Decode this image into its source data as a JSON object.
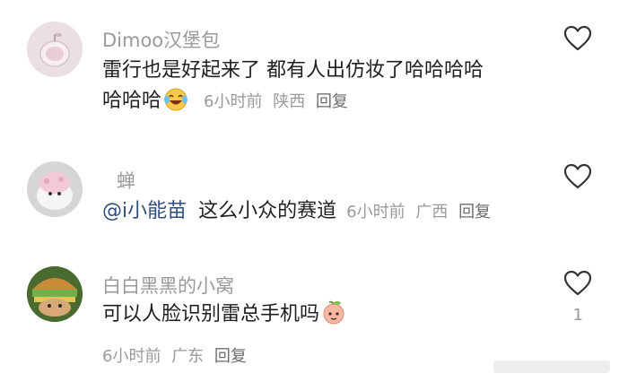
{
  "comments": [
    {
      "username": "Dimoo汉堡包",
      "text_line1": "雷行也是好起来了 都有人出仿妆了哈哈哈哈",
      "text_line2": "哈哈哈",
      "emoji": "laughing-tears-emoji",
      "time": "6小时前",
      "location": "陕西",
      "reply": "回复",
      "like_icon": "heart-outline-icon"
    },
    {
      "username": "蝉",
      "mention": "@i小能苗",
      "text": "这么小众的赛道",
      "time": "6小时前",
      "location": "广西",
      "reply": "回复",
      "like_icon": "heart-outline-icon"
    },
    {
      "username": "白白黑黑的小窝",
      "text": "可以人脸识别雷总手机吗",
      "emoji": "peach-face-emoji",
      "time": "6小时前",
      "location": "广东",
      "reply": "回复",
      "like_icon": "heart-outline-icon",
      "like_count": "1"
    }
  ],
  "colors": {
    "username": "#9a9a9a",
    "text": "#1f1f1f",
    "mention": "#2f4d7e",
    "meta": "#9a9a9a"
  }
}
